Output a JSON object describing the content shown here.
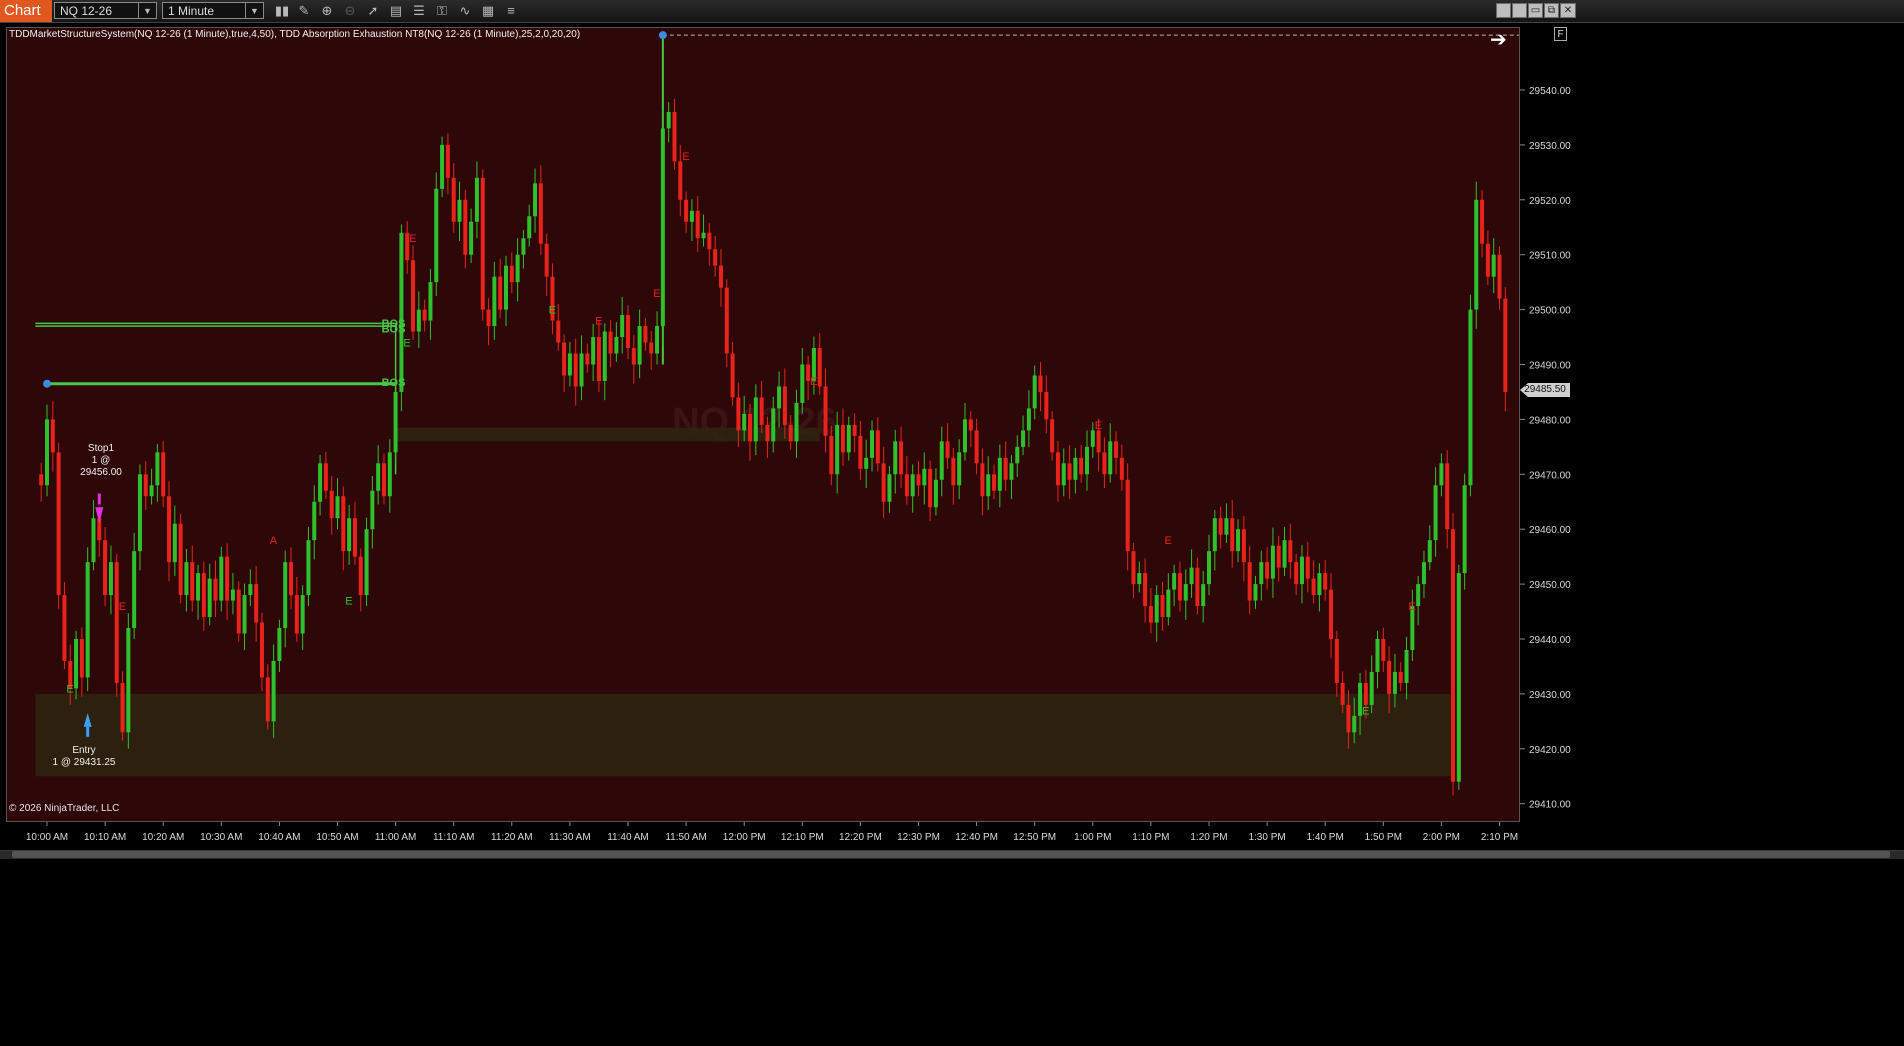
{
  "toolbar": {
    "chart_tab": "Chart",
    "instrument": "NQ 12-26",
    "interval": "1 Minute",
    "icons": [
      "bars-type-icon",
      "drawing-tools-icon",
      "zoom-in-icon",
      "zoom-out-icon",
      "pointer-icon",
      "chart-trader-icon",
      "properties-icon",
      "strategies-icon",
      "indicators-icon",
      "data-box-icon"
    ]
  },
  "window_controls": [
    "minimize-icon",
    "maximize-icon",
    "restore-icon",
    "close-icon"
  ],
  "plot": {
    "indicator_label": "TDDMarketStructureSystem(NQ 12-26 (1 Minute),true,4,50), TDD Absorption Exhaustion NT8(NQ 12-26 (1 Minute),25,2,0,20,20)",
    "watermark": "NQ 12-26",
    "copyright": "© 2026 NinjaTrader, LLC",
    "f_button": "F",
    "arrow_icon": "right-arrow-icon",
    "last_price": "29485.50"
  },
  "orders": {
    "stop_title": "Stop1",
    "stop_detail": "1 @ 29456.00",
    "entry_title": "Entry",
    "entry_detail": "1 @ 29431.25"
  },
  "markers": {
    "bos": "BOS",
    "exhaustion": "E",
    "absorption": "A"
  },
  "colors": {
    "background": "#2e0809",
    "up_candle": "#2ec12e",
    "down_candle": "#e8231b",
    "structure_line": "#45c845",
    "zone": "#2f2310",
    "accent": "#e0581f",
    "stop_marker": "#e030e0",
    "entry_marker": "#3aa0ff"
  },
  "chart_data": {
    "type": "candlestick",
    "symbol": "NQ 12-26",
    "interval": "1 Minute",
    "y_ticks": [
      "29410.00",
      "29420.00",
      "29430.00",
      "29440.00",
      "29450.00",
      "29460.00",
      "29470.00",
      "29480.00",
      "29490.00",
      "29500.00",
      "29510.00",
      "29520.00",
      "29530.00",
      "29540.00"
    ],
    "x_ticks": [
      "10:00 AM",
      "10:10 AM",
      "10:20 AM",
      "10:30 AM",
      "10:40 AM",
      "10:50 AM",
      "11:00 AM",
      "11:10 AM",
      "11:20 AM",
      "11:30 AM",
      "11:40 AM",
      "11:50 AM",
      "12:00 PM",
      "12:10 PM",
      "12:20 PM",
      "12:30 PM",
      "12:40 PM",
      "12:50 PM",
      "1:00 PM",
      "1:10 PM",
      "1:20 PM",
      "1:30 PM",
      "1:40 PM",
      "1:50 PM",
      "2:00 PM",
      "2:10 PM"
    ],
    "ylim": [
      29407,
      29550
    ],
    "close_path": [
      [
        "09:58",
        29470
      ],
      [
        "09:59",
        29468
      ],
      [
        "10:00",
        29480
      ],
      [
        "10:01",
        29474
      ],
      [
        "10:02",
        29448
      ],
      [
        "10:03",
        29436
      ],
      [
        "10:04",
        29431
      ],
      [
        "10:05",
        29440
      ],
      [
        "10:06",
        29433
      ],
      [
        "10:07",
        29454
      ],
      [
        "10:08",
        29462
      ],
      [
        "10:09",
        29458
      ],
      [
        "10:10",
        29448
      ],
      [
        "10:11",
        29454
      ],
      [
        "10:12",
        29432
      ],
      [
        "10:13",
        29423
      ],
      [
        "10:14",
        29442
      ],
      [
        "10:15",
        29456
      ],
      [
        "10:16",
        29470
      ],
      [
        "10:17",
        29466
      ],
      [
        "10:18",
        29468
      ],
      [
        "10:19",
        29474
      ],
      [
        "10:20",
        29466
      ],
      [
        "10:21",
        29454
      ],
      [
        "10:22",
        29461
      ],
      [
        "10:23",
        29448
      ],
      [
        "10:24",
        29454
      ],
      [
        "10:25",
        29447
      ],
      [
        "10:26",
        29452
      ],
      [
        "10:27",
        29444
      ],
      [
        "10:28",
        29451
      ],
      [
        "10:29",
        29447
      ],
      [
        "10:30",
        29455
      ],
      [
        "10:31",
        29447
      ],
      [
        "10:32",
        29449
      ],
      [
        "10:33",
        29441
      ],
      [
        "10:34",
        29448
      ],
      [
        "10:35",
        29450
      ],
      [
        "10:36",
        29443
      ],
      [
        "10:37",
        29433
      ],
      [
        "10:38",
        29425
      ],
      [
        "10:39",
        29436
      ],
      [
        "10:40",
        29442
      ],
      [
        "10:41",
        29454
      ],
      [
        "10:42",
        29448
      ],
      [
        "10:43",
        29441
      ],
      [
        "10:44",
        29448
      ],
      [
        "10:45",
        29458
      ],
      [
        "10:46",
        29465
      ],
      [
        "10:47",
        29472
      ],
      [
        "10:48",
        29467
      ],
      [
        "10:49",
        29462
      ],
      [
        "10:50",
        29466
      ],
      [
        "10:51",
        29456
      ],
      [
        "10:52",
        29462
      ],
      [
        "10:53",
        29455
      ],
      [
        "10:54",
        29448
      ],
      [
        "10:55",
        29460
      ],
      [
        "10:56",
        29467
      ],
      [
        "10:57",
        29472
      ],
      [
        "10:58",
        29466
      ],
      [
        "10:59",
        29474
      ],
      [
        "11:00",
        29485
      ],
      [
        "11:01",
        29514
      ],
      [
        "11:02",
        29509
      ],
      [
        "11:03",
        29496
      ],
      [
        "11:04",
        29500
      ],
      [
        "11:05",
        29498
      ],
      [
        "11:06",
        29505
      ],
      [
        "11:07",
        29522
      ],
      [
        "11:08",
        29530
      ],
      [
        "11:09",
        29524
      ],
      [
        "11:10",
        29516
      ],
      [
        "11:11",
        29520
      ],
      [
        "11:12",
        29510
      ],
      [
        "11:13",
        29516
      ],
      [
        "11:14",
        29524
      ],
      [
        "11:15",
        29500
      ],
      [
        "11:16",
        29497
      ],
      [
        "11:17",
        29506
      ],
      [
        "11:18",
        29500
      ],
      [
        "11:19",
        29508
      ],
      [
        "11:20",
        29505
      ],
      [
        "11:21",
        29510
      ],
      [
        "11:22",
        29513
      ],
      [
        "11:23",
        29517
      ],
      [
        "11:24",
        29523
      ],
      [
        "11:25",
        29512
      ],
      [
        "11:26",
        29506
      ],
      [
        "11:27",
        29498
      ],
      [
        "11:28",
        29494
      ],
      [
        "11:29",
        29488
      ],
      [
        "11:30",
        29492
      ],
      [
        "11:31",
        29486
      ],
      [
        "11:32",
        29492
      ],
      [
        "11:33",
        29490
      ],
      [
        "11:34",
        29495
      ],
      [
        "11:35",
        29487
      ],
      [
        "11:36",
        29496
      ],
      [
        "11:37",
        29492
      ],
      [
        "11:38",
        29495
      ],
      [
        "11:39",
        29499
      ],
      [
        "11:40",
        29493
      ],
      [
        "11:41",
        29490
      ],
      [
        "11:42",
        29497
      ],
      [
        "11:43",
        29494
      ],
      [
        "11:44",
        29492
      ],
      [
        "11:45",
        29497
      ],
      [
        "11:46",
        29533
      ],
      [
        "11:47",
        29536
      ],
      [
        "11:48",
        29527
      ],
      [
        "11:49",
        29520
      ],
      [
        "11:50",
        29516
      ],
      [
        "11:51",
        29518
      ],
      [
        "11:52",
        29513
      ],
      [
        "11:53",
        29514
      ],
      [
        "11:54",
        29511
      ],
      [
        "11:55",
        29508
      ],
      [
        "11:56",
        29504
      ],
      [
        "11:57",
        29492
      ],
      [
        "11:58",
        29484
      ],
      [
        "11:59",
        29478
      ],
      [
        "12:00",
        29481
      ],
      [
        "12:01",
        29476
      ],
      [
        "12:02",
        29484
      ],
      [
        "12:03",
        29479
      ],
      [
        "12:04",
        29476
      ],
      [
        "12:05",
        29482
      ],
      [
        "12:06",
        29486
      ],
      [
        "12:07",
        29479
      ],
      [
        "12:08",
        29476
      ],
      [
        "12:09",
        29483
      ],
      [
        "12:10",
        29490
      ],
      [
        "12:11",
        29487
      ],
      [
        "12:12",
        29493
      ],
      [
        "12:13",
        29486
      ],
      [
        "12:14",
        29477
      ],
      [
        "12:15",
        29470
      ],
      [
        "12:16",
        29479
      ],
      [
        "12:17",
        29474
      ],
      [
        "12:18",
        29479
      ],
      [
        "12:19",
        29477
      ],
      [
        "12:20",
        29471
      ],
      [
        "12:21",
        29473
      ],
      [
        "12:22",
        29478
      ],
      [
        "12:23",
        29472
      ],
      [
        "12:24",
        29465
      ],
      [
        "12:25",
        29470
      ],
      [
        "12:26",
        29476
      ],
      [
        "12:27",
        29470
      ],
      [
        "12:28",
        29466
      ],
      [
        "12:29",
        29470
      ],
      [
        "12:30",
        29468
      ],
      [
        "12:31",
        29471
      ],
      [
        "12:32",
        29464
      ],
      [
        "12:33",
        29469
      ],
      [
        "12:34",
        29476
      ],
      [
        "12:35",
        29473
      ],
      [
        "12:36",
        29468
      ],
      [
        "12:37",
        29474
      ],
      [
        "12:38",
        29480
      ],
      [
        "12:39",
        29478
      ],
      [
        "12:40",
        29472
      ],
      [
        "12:41",
        29466
      ],
      [
        "12:42",
        29470
      ],
      [
        "12:43",
        29467
      ],
      [
        "12:44",
        29473
      ],
      [
        "12:45",
        29469
      ],
      [
        "12:46",
        29472
      ],
      [
        "12:47",
        29475
      ],
      [
        "12:48",
        29478
      ],
      [
        "12:49",
        29482
      ],
      [
        "12:50",
        29488
      ],
      [
        "12:51",
        29485
      ],
      [
        "12:52",
        29480
      ],
      [
        "12:53",
        29474
      ],
      [
        "12:54",
        29468
      ],
      [
        "12:55",
        29472
      ],
      [
        "12:56",
        29469
      ],
      [
        "12:57",
        29473
      ],
      [
        "12:58",
        29470
      ],
      [
        "12:59",
        29475
      ],
      [
        "13:00",
        29478
      ],
      [
        "13:01",
        29474
      ],
      [
        "13:02",
        29470
      ],
      [
        "13:03",
        29476
      ],
      [
        "13:04",
        29473
      ],
      [
        "13:05",
        29469
      ],
      [
        "13:06",
        29456
      ],
      [
        "13:07",
        29450
      ],
      [
        "13:08",
        29452
      ],
      [
        "13:09",
        29446
      ],
      [
        "13:10",
        29443
      ],
      [
        "13:11",
        29448
      ],
      [
        "13:12",
        29444
      ],
      [
        "13:13",
        29449
      ],
      [
        "13:14",
        29452
      ],
      [
        "13:15",
        29447
      ],
      [
        "13:16",
        29450
      ],
      [
        "13:17",
        29453
      ],
      [
        "13:18",
        29446
      ],
      [
        "13:19",
        29450
      ],
      [
        "13:20",
        29456
      ],
      [
        "13:21",
        29462
      ],
      [
        "13:22",
        29459
      ],
      [
        "13:23",
        29462
      ],
      [
        "13:24",
        29456
      ],
      [
        "13:25",
        29460
      ],
      [
        "13:26",
        29454
      ],
      [
        "13:27",
        29447
      ],
      [
        "13:28",
        29450
      ],
      [
        "13:29",
        29454
      ],
      [
        "13:30",
        29451
      ],
      [
        "13:31",
        29457
      ],
      [
        "13:32",
        29453
      ],
      [
        "13:33",
        29458
      ],
      [
        "13:34",
        29454
      ],
      [
        "13:35",
        29450
      ],
      [
        "13:36",
        29455
      ],
      [
        "13:37",
        29451
      ],
      [
        "13:38",
        29448
      ],
      [
        "13:39",
        29452
      ],
      [
        "13:40",
        29449
      ],
      [
        "13:41",
        29440
      ],
      [
        "13:42",
        29432
      ],
      [
        "13:43",
        29428
      ],
      [
        "13:44",
        29423
      ],
      [
        "13:45",
        29426
      ],
      [
        "13:46",
        29432
      ],
      [
        "13:47",
        29428
      ],
      [
        "13:48",
        29434
      ],
      [
        "13:49",
        29440
      ],
      [
        "13:50",
        29436
      ],
      [
        "13:51",
        29430
      ],
      [
        "13:52",
        29434
      ],
      [
        "13:53",
        29432
      ],
      [
        "13:54",
        29438
      ],
      [
        "13:55",
        29446
      ],
      [
        "13:56",
        29450
      ],
      [
        "13:57",
        29454
      ],
      [
        "13:58",
        29458
      ],
      [
        "13:59",
        29468
      ],
      [
        "14:00",
        29472
      ],
      [
        "14:01",
        29460
      ],
      [
        "14:02",
        29414
      ],
      [
        "14:03",
        29452
      ],
      [
        "14:04",
        29468
      ],
      [
        "14:05",
        29500
      ],
      [
        "14:06",
        29520
      ],
      [
        "14:07",
        29512
      ],
      [
        "14:08",
        29506
      ],
      [
        "14:09",
        29510
      ],
      [
        "14:10",
        29502
      ],
      [
        "14:11",
        29485
      ]
    ],
    "levels": [
      {
        "name": "BOS",
        "price": 29497.5,
        "from": "09:58",
        "to": "11:00"
      },
      {
        "name": "BOS",
        "price": 29497,
        "from": "09:58",
        "to": "11:00"
      },
      {
        "name": "BOS",
        "price": 29486.5,
        "from": "10:00",
        "to": "11:00"
      },
      {
        "name": "swing high",
        "price": 29550,
        "from": "11:46",
        "to": "14:15"
      }
    ],
    "zones": [
      {
        "name": "upper zone",
        "from_price": 29476,
        "to_price": 29478.5,
        "from": "11:00",
        "to": "12:13"
      },
      {
        "name": "lower zone",
        "from_price": 29415,
        "to_price": 29430,
        "from": "09:58",
        "to": "14:02"
      }
    ]
  }
}
